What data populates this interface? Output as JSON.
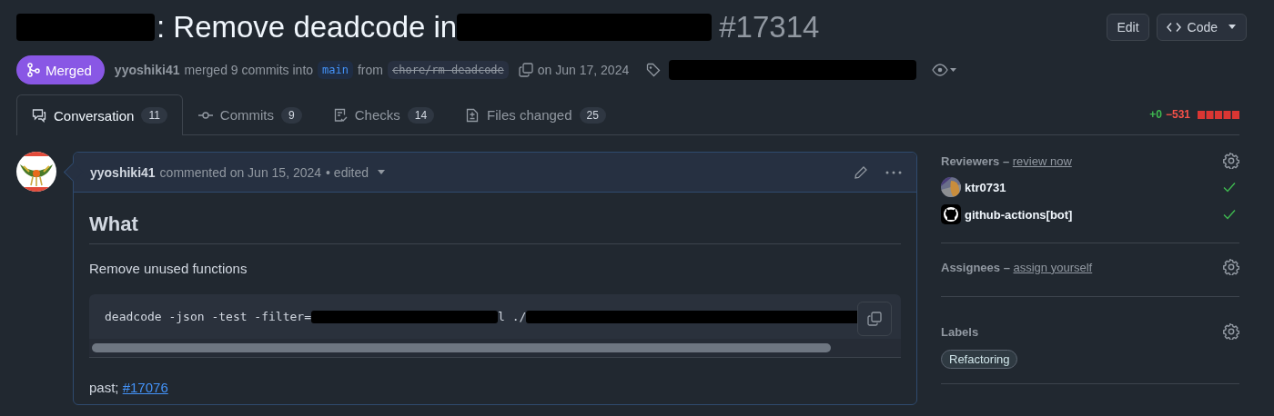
{
  "title": {
    "parts": [
      {
        "kind": "redacted"
      },
      {
        "kind": "text",
        "text": ": Remove deadcode in"
      },
      {
        "kind": "redacted"
      },
      {
        "kind": "number",
        "text": "#17314"
      }
    ]
  },
  "header_buttons": [
    {
      "label": "Edit",
      "kind": "plain"
    },
    {
      "label": "Code",
      "kind": "code"
    }
  ],
  "meta": {
    "state": "Merged",
    "author": "yyoshiki41",
    "action": "merged 9 commits into",
    "base": "main",
    "from": "from",
    "head": {
      "name": "chore/rm-deadcode",
      "deleted": true
    },
    "date": "on Jun 17, 2024"
  },
  "tabs": [
    {
      "label": "Conversation",
      "count": "11",
      "selected": true,
      "kind": "conversation"
    },
    {
      "label": "Commits",
      "count": "9",
      "selected": false,
      "kind": "commits"
    },
    {
      "label": "Checks",
      "count": "14",
      "selected": false,
      "kind": "checks"
    },
    {
      "label": "Files changed",
      "count": "25",
      "selected": false,
      "kind": "files"
    }
  ],
  "diffstat": {
    "additions": "+0",
    "deletions": "−531"
  },
  "comment": {
    "author": "yyoshiki41",
    "action": "commented on Jun 15, 2024",
    "edited": "• edited",
    "heading": "What",
    "paragraph": "Remove unused functions",
    "code": [
      {
        "kind": "text",
        "text": "deadcode -json -test -filter="
      },
      {
        "kind": "redacted"
      },
      {
        "kind": "text",
        "text": "l ./"
      },
      {
        "kind": "redacted"
      }
    ],
    "footer": "past;",
    "link": "#17076"
  },
  "sidebar": {
    "reviewers": {
      "title": "Reviewers",
      "separator": "–",
      "action": "review now",
      "items": [
        {
          "name": "ktr0731",
          "kind": "user",
          "approved": true
        },
        {
          "name": "github-actions[bot]",
          "kind": "bot",
          "approved": true
        }
      ]
    },
    "assignees": {
      "title": "Assignees",
      "separator": "–",
      "action": "assign yourself"
    },
    "labels": {
      "title": "Labels",
      "items": [
        "Refactoring"
      ]
    }
  }
}
